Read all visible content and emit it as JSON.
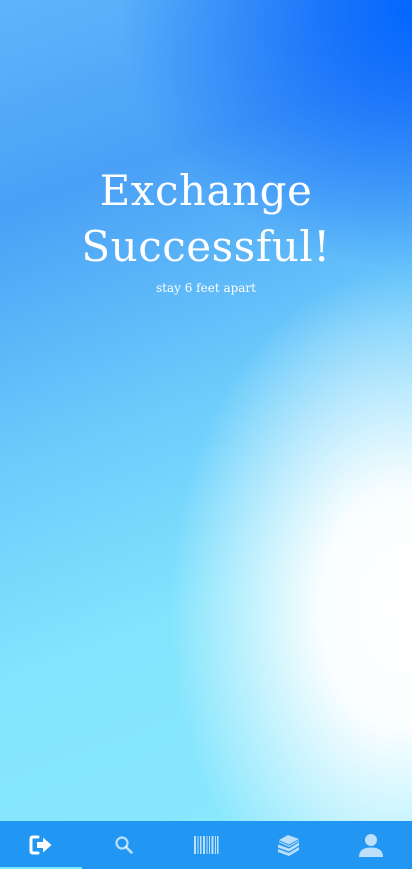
{
  "screen": {
    "headline_line1": "Exchange",
    "headline_line2": "Successful!",
    "subtitle": "stay 6 feet apart"
  },
  "tabbar": {
    "background": "#2196f3",
    "active_color": "#ffffff",
    "inactive_color": "rgba(255,255,255,0.65)",
    "indicator_color": "#7fe6ff",
    "tabs": [
      {
        "icon": "sign-out-icon",
        "active": true
      },
      {
        "icon": "search-icon",
        "active": false
      },
      {
        "icon": "barcode-icon",
        "active": false
      },
      {
        "icon": "books-icon",
        "active": false
      },
      {
        "icon": "user-icon",
        "active": false
      }
    ]
  }
}
